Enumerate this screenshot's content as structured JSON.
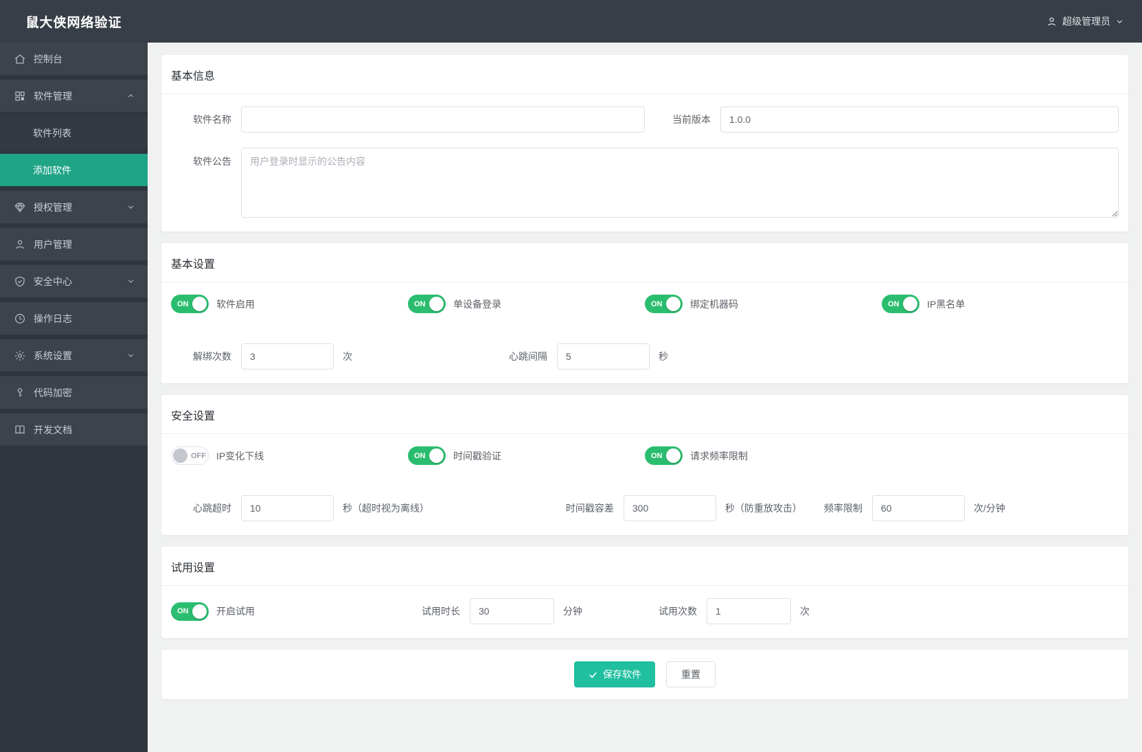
{
  "app": {
    "title": "鼠大侠网络验证",
    "user_name": "超级管理员"
  },
  "sidebar": {
    "items": [
      {
        "label": "控制台",
        "icon": "home-icon"
      },
      {
        "label": "软件管理",
        "icon": "apps-icon",
        "expanded": true
      },
      {
        "label": "软件列表",
        "submenu": true
      },
      {
        "label": "添加软件",
        "submenu": true,
        "active": true
      },
      {
        "label": "授权管理",
        "icon": "gem-icon",
        "collapsible": true
      },
      {
        "label": "用户管理",
        "icon": "user-icon"
      },
      {
        "label": "安全中心",
        "icon": "shield-check-icon",
        "collapsible": true
      },
      {
        "label": "操作日志",
        "icon": "clock-icon"
      },
      {
        "label": "系统设置",
        "icon": "gear-icon",
        "collapsible": true
      },
      {
        "label": "代码加密",
        "icon": "key-icon"
      },
      {
        "label": "开发文档",
        "icon": "book-icon"
      }
    ]
  },
  "basic_info": {
    "title": "基本信息",
    "name_label": "软件名称",
    "name_value": "",
    "version_label": "当前版本",
    "version_value": "1.0.0",
    "announcement_label": "软件公告",
    "announcement_placeholder": "用户登录时显示的公告内容"
  },
  "basic_settings": {
    "title": "基本设置",
    "toggles": [
      {
        "label": "软件启用",
        "state": "ON"
      },
      {
        "label": "单设备登录",
        "state": "ON"
      },
      {
        "label": "绑定机器码",
        "state": "ON"
      },
      {
        "label": "IP黑名单",
        "state": "ON"
      }
    ],
    "unbind": {
      "label": "解绑次数",
      "value": "3",
      "suffix": "次"
    },
    "heartbeat": {
      "label": "心跳间隔",
      "value": "5",
      "suffix": "秒"
    }
  },
  "security_settings": {
    "title": "安全设置",
    "toggles": [
      {
        "label": "IP变化下线",
        "state": "OFF"
      },
      {
        "label": "时间戳验证",
        "state": "ON"
      },
      {
        "label": "请求频率限制",
        "state": "ON"
      }
    ],
    "heartbeat_timeout": {
      "label": "心跳超时",
      "value": "10",
      "suffix": "秒（超时视为离线）"
    },
    "timestamp_tolerance": {
      "label": "时间戳容差",
      "value": "300",
      "suffix": "秒（防重放攻击）"
    },
    "rate_limit": {
      "label": "频率限制",
      "value": "60",
      "suffix": "次/分钟"
    }
  },
  "trial_settings": {
    "title": "试用设置",
    "toggle": {
      "label": "开启试用",
      "state": "ON"
    },
    "duration": {
      "label": "试用时长",
      "value": "30",
      "suffix": "分钟"
    },
    "count": {
      "label": "试用次数",
      "value": "1",
      "suffix": "次"
    }
  },
  "actions": {
    "save": "保存软件",
    "reset": "重置"
  },
  "colors": {
    "primary_green": "#1fbfa0",
    "toggle_on_green": "#2bbd6f",
    "sidebar_active_green": "#1fa485",
    "header_bg": "#383e47",
    "sidebar_bg": "#2f3640",
    "content_bg": "#f0f1f1"
  }
}
